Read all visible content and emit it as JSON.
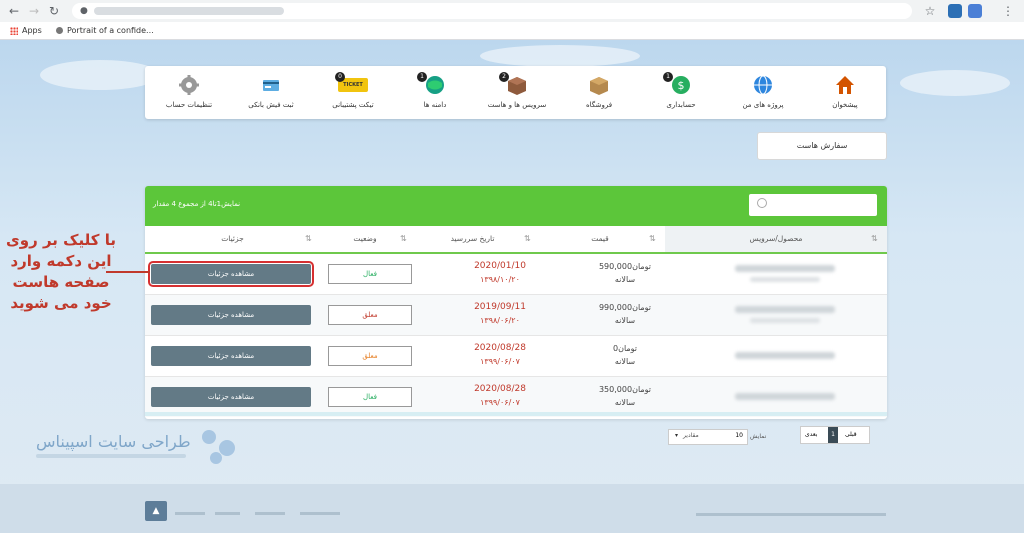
{
  "browser": {
    "bookmarks": [
      {
        "label": "Apps"
      },
      {
        "label": "Portrait of a confide..."
      }
    ]
  },
  "nav": {
    "items": [
      {
        "label": "پیشخوان",
        "icon": "house-icon",
        "count": ""
      },
      {
        "label": "پروژه های من",
        "icon": "globe-icon",
        "count": ""
      },
      {
        "label": "حسابداری",
        "icon": "accounting-icon",
        "count": "1"
      },
      {
        "label": "فروشگاه",
        "icon": "shop-box-icon",
        "count": ""
      },
      {
        "label": "سرویس ها و هاست",
        "icon": "service-box-icon",
        "count": "2"
      },
      {
        "label": "دامنه ها",
        "icon": "domain-globe-icon",
        "count": "1"
      },
      {
        "label": "تیکت پشتیبانی",
        "icon": "ticket-icon",
        "count": "0",
        "icon_text": "TICKET"
      },
      {
        "label": "ثبت فیش بانکی",
        "icon": "bank-receipt-icon",
        "count": ""
      },
      {
        "label": "تنظیمات حساب",
        "icon": "gear-icon",
        "count": ""
      }
    ]
  },
  "host_order_button": "سفارش هاست",
  "table": {
    "info": "نمایش1تا4 از مجموع 4 مقدار",
    "columns": {
      "product": "محصول/سرویس",
      "price": "قیمت",
      "due": "تاریخ سررسید",
      "status": "وضعیت",
      "details": "جزئیات"
    },
    "rows": [
      {
        "price": "590,000تومان",
        "cycle": "سالانه",
        "date": "2020/01/10",
        "date_fa": "۱۳۹۸/۱۰/۲۰",
        "status": "فعال",
        "details": "مشاهده جزئیات"
      },
      {
        "price": "990,000تومان",
        "cycle": "سالانه",
        "date": "2019/09/11",
        "date_fa": "۱۳۹۸/۰۶/۲۰",
        "status": "معلق",
        "details": "مشاهده جزئیات"
      },
      {
        "price": "0تومان",
        "cycle": "سالانه",
        "date": "2020/08/28",
        "date_fa": "۱۳۹۹/۰۶/۰۷",
        "status": "معلق",
        "details": "مشاهده جزئیات"
      },
      {
        "price": "350,000تومان",
        "cycle": "سالانه",
        "date": "2020/08/28",
        "date_fa": "۱۳۹۹/۰۶/۰۷",
        "status": "فعال",
        "details": "مشاهده جزئیات"
      }
    ]
  },
  "pagination": {
    "prev": "قبلی",
    "current": "1",
    "next": "بعدی",
    "show_label": "نمایش",
    "show_value": "10",
    "show_suffix": "مقادیر"
  },
  "annotation": "با کلیک بر روی این دکمه وارد صفحه هاست خود می شوید",
  "watermark": {
    "title": "طراحی سایت اسپیناس"
  },
  "colors": {
    "green": "#5cc63a",
    "detail_button": "#637a86",
    "active": "#27ae60",
    "suspended": "#c0392b",
    "pending": "#e67e22"
  }
}
